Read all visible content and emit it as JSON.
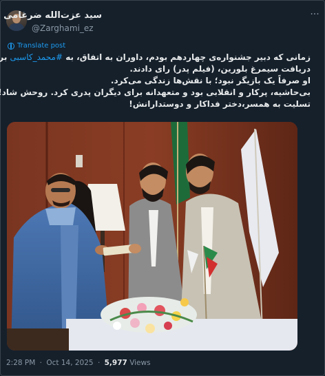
{
  "author": {
    "name": "سید عزت‌الله ضرغامی",
    "handle": "@Zarghami_ez"
  },
  "translate_label": "Translate post",
  "tweet": {
    "line1_before": "زمانی که دبیر جشنواره‌ی چهاردهم بودم، داوران به اتفاق، به ",
    "hashtag": "#محمد_کاسبی",
    "line1_after": " برای",
    "line2": "دریافت سیمرغ بلورین، (فیلم پدر) رای دادند.",
    "line3": "او صرفاً یک بازیگر نبود؛ با نقش‌ها زندگی می‌کرد.",
    "line4": "بی‌حاشیه، پرکار و انقلابی بود و متعهدانه برای دیگران پدری کرد. روحش شاد!",
    "line5": "تسلیت به همسر،دختر فداکار و دوستدارانش!"
  },
  "meta": {
    "time": "2:28 PM",
    "separator": "·",
    "date": "Oct 14, 2025",
    "views_count": "5,977",
    "views_label": "Views"
  },
  "icons": {
    "more": "more-options-icon",
    "translate": "globe-icon"
  },
  "colors": {
    "background": "#15202b",
    "text": "#e7e9ea",
    "secondary": "#8b98a5",
    "accent": "#1d9bf0",
    "border": "#38444d"
  }
}
